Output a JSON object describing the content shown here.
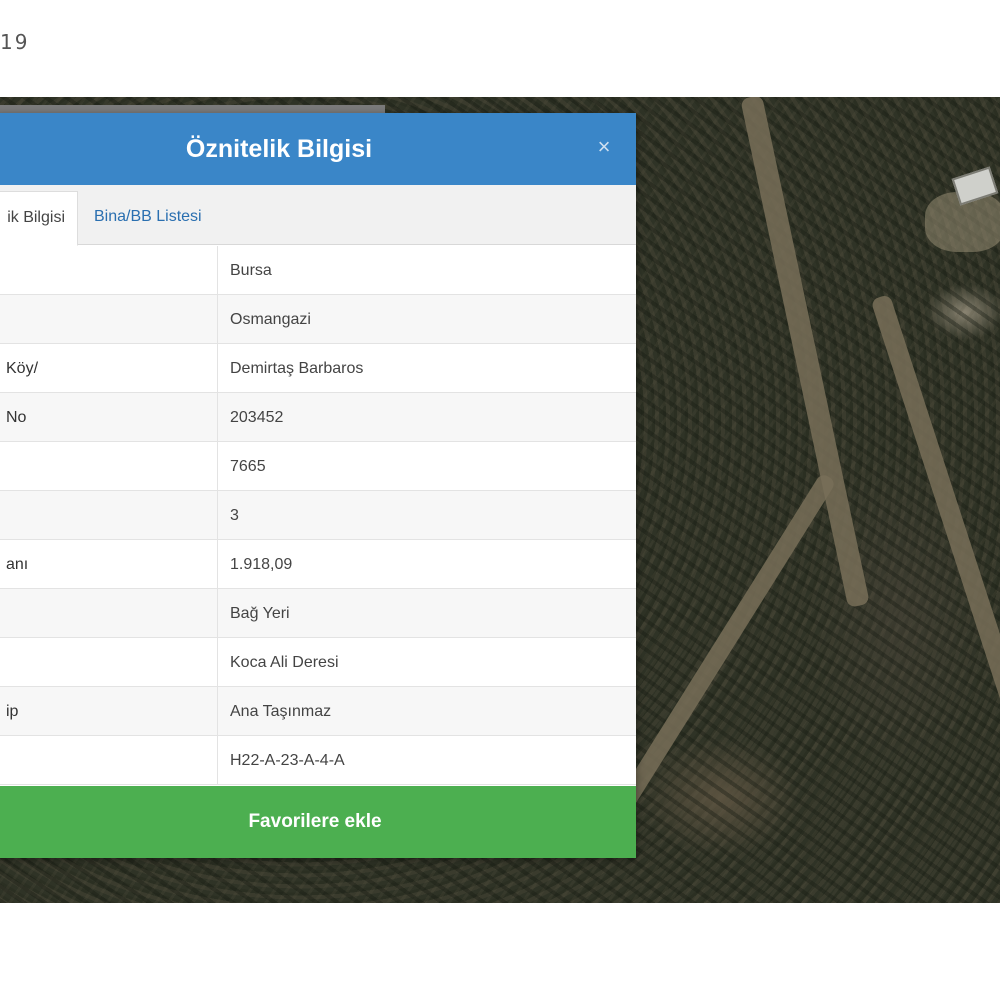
{
  "page": {
    "top_text": "19"
  },
  "dialog": {
    "title": "Öznitelik Bilgisi",
    "close_label": "×",
    "tabs": [
      {
        "label": "ik Bilgisi",
        "active": true
      },
      {
        "label": "Bina/BB Listesi",
        "active": false
      }
    ],
    "rows": [
      {
        "key": "",
        "value": "Bursa"
      },
      {
        "key": "",
        "value": "Osmangazi"
      },
      {
        "key": "/Köy",
        "value": "Demirtaş Barbaros"
      },
      {
        "key": "No",
        "value": "203452"
      },
      {
        "key": "",
        "value": "7665"
      },
      {
        "key": "",
        "value": "3"
      },
      {
        "key": "anı",
        "value": "1.918,09"
      },
      {
        "key": "",
        "value": "Bağ Yeri"
      },
      {
        "key": "",
        "value": "Koca Ali Deresi"
      },
      {
        "key": "ip",
        "value": "Ana Taşınmaz"
      },
      {
        "key": "",
        "value": "H22-A-23-A-4-A"
      }
    ],
    "favorite_button": "Favorilere ekle"
  },
  "colors": {
    "header_blue": "#3a86c8",
    "tab_link_blue": "#2a6fb0",
    "button_green": "#4caf50"
  }
}
